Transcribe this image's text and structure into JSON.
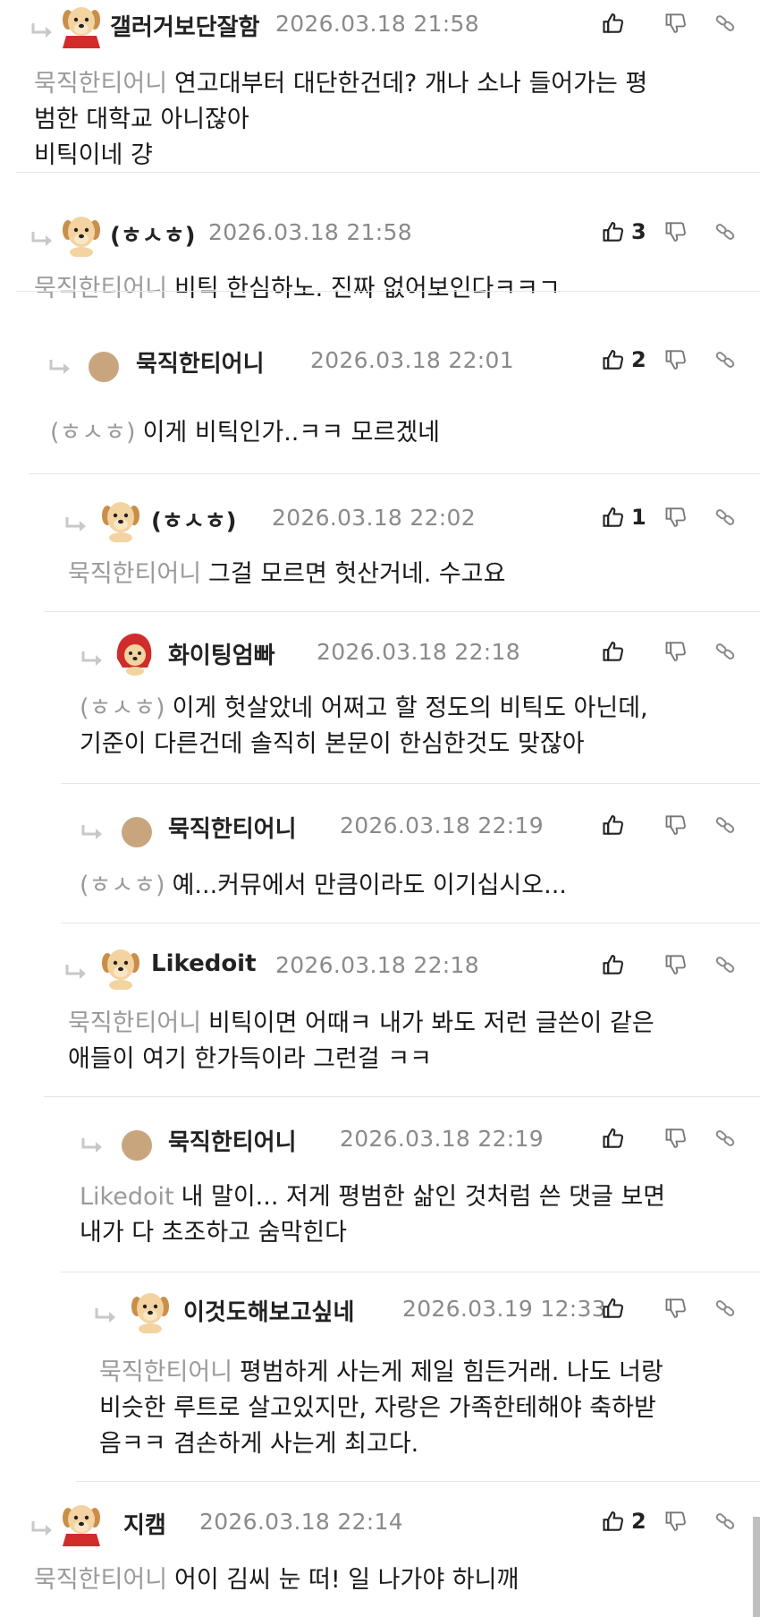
{
  "comments": [
    {
      "nick": "갤러거보단잘함",
      "date": "2026.03.18 21:58",
      "like_count": "",
      "mention": "묵직한티어니",
      "lines": [
        "연고대부터 대단한건데? 개나 소나 들어가는 평",
        "범한 대학교 아니잖아",
        "비틱이네 걍"
      ],
      "avatar": "puppy-red-cape"
    },
    {
      "nick": "(ㅎㅅㅎ)",
      "date": "2026.03.18 21:58",
      "like_count": "3",
      "mention": "묵직한티어니",
      "lines": [
        "비틱 한심하노. 진짜 없어보인다ㅋㅋㄱ"
      ],
      "avatar": "puppy"
    },
    {
      "nick": "묵직한티어니",
      "date": "2026.03.18 22:01",
      "like_count": "2",
      "mention": "(ㅎㅅㅎ)",
      "lines": [
        "이게 비틱인가..ㅋㅋ 모르겠네"
      ],
      "avatar": "dot"
    },
    {
      "nick": "(ㅎㅅㅎ)",
      "date": "2026.03.18 22:02",
      "like_count": "1",
      "mention": "묵직한티어니",
      "lines": [
        "그걸 모르면 헛산거네. 수고요"
      ],
      "avatar": "puppy"
    },
    {
      "nick": "화이팅엄빠",
      "date": "2026.03.18 22:18",
      "like_count": "",
      "mention": "(ㅎㅅㅎ)",
      "lines": [
        "이게 헛살았네 어쩌고 할 정도의 비틱도 아닌데,",
        "기준이 다른건데 솔직히 본문이 한심한것도 맞잖아"
      ],
      "avatar": "puppy-red-hood"
    },
    {
      "nick": "묵직한티어니",
      "date": "2026.03.18 22:19",
      "like_count": "",
      "mention": "(ㅎㅅㅎ)",
      "lines": [
        "예...커뮤에서 만큼이라도 이기십시오..."
      ],
      "avatar": "dot"
    },
    {
      "nick": "Likedoit",
      "date": "2026.03.18 22:18",
      "like_count": "",
      "mention": "묵직한티어니",
      "lines": [
        "비틱이면 어때ㅋ 내가 봐도 저런 글쓴이 같은",
        "애들이 여기 한가득이라 그런걸 ㅋㅋ"
      ],
      "avatar": "puppy"
    },
    {
      "nick": "묵직한티어니",
      "date": "2026.03.18 22:19",
      "like_count": "",
      "mention": "Likedoit",
      "lines": [
        "내 말이... 저게 평범한 삶인 것처럼 쓴 댓글 보면",
        "내가 다 초조하고 숨막힌다"
      ],
      "avatar": "dot"
    },
    {
      "nick": "이것도해보고싶네",
      "date": "2026.03.19 12:33",
      "like_count": "",
      "mention": "묵직한티어니",
      "lines": [
        "평범하게 사는게 제일 힘든거래. 나도 너랑",
        "비슷한 루트로 살고있지만, 자랑은 가족한테해야 축하받",
        "음ㅋㅋ 겸손하게 사는게 최고다."
      ],
      "avatar": "puppy"
    },
    {
      "nick": "지캠",
      "date": "2026.03.18 22:14",
      "like_count": "2",
      "mention": "묵직한티어니",
      "lines": [
        "어이 김씨 눈 떠! 일 나가야 하니깨"
      ],
      "avatar": "puppy-red-cape"
    }
  ],
  "icons": {
    "like": "thumbs-up-icon",
    "dislike": "thumbs-down-icon",
    "link": "link-icon",
    "reply": "reply-arrow-icon"
  },
  "colors": {
    "mention": "#9a9a9a",
    "date": "#8a8a8a",
    "separator": "#e6e6e6",
    "dot_avatar": "#c9a57e"
  }
}
